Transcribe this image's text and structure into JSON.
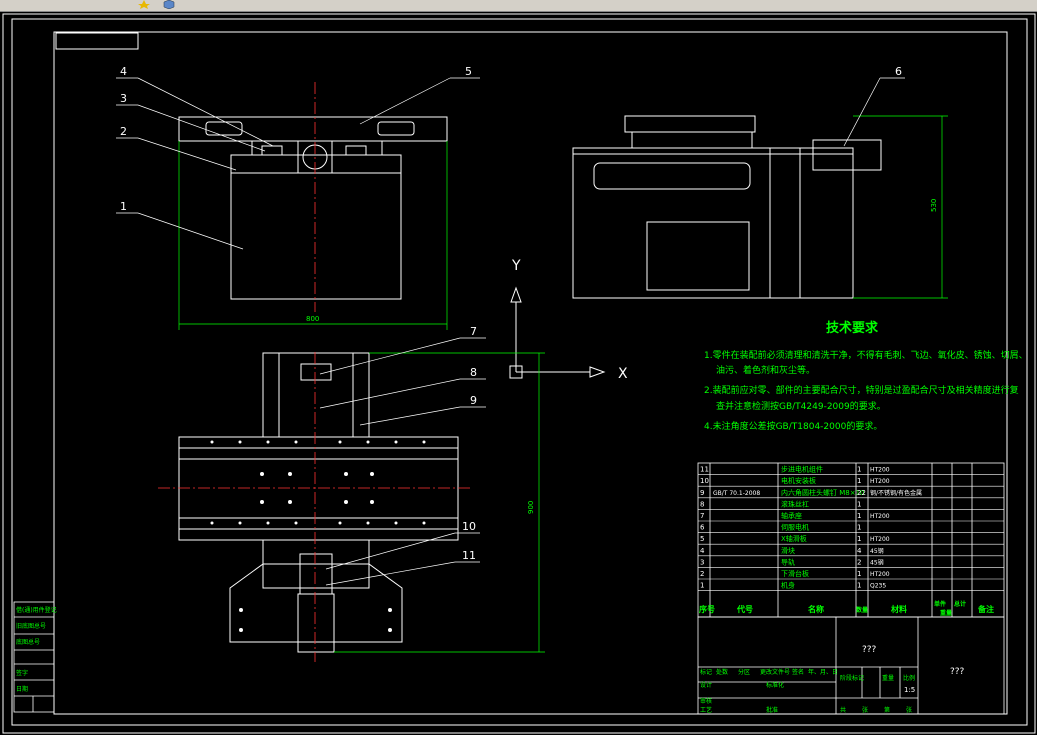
{
  "toolbar": {
    "icons": [
      "yellow-star-icon",
      "blue-cube-icon"
    ]
  },
  "drawing": {
    "axis_y_label": "Y",
    "axis_x_label": "X",
    "dim_width": "800",
    "dim_height_right": "530",
    "dim_height_bottom": "900",
    "balloons": [
      "1",
      "2",
      "3",
      "4",
      "5",
      "6",
      "7",
      "8",
      "9",
      "10",
      "11"
    ],
    "tech_title": "技术要求",
    "tech_lines": [
      "1.零件在装配前必须清理和清洗干净，不得有毛刺、飞边、氧化皮、锈蚀、切屑、",
      "油污、着色剂和灰尘等。",
      "2.装配前应对零、部件的主要配合尺寸，特别是过盈配合尺寸及相关精度进行复",
      "查并注意检测按GB/T4249-2009的要求。",
      "4.未注角度公差按GB/T1804-2000的要求。"
    ]
  },
  "bom": {
    "rows": [
      {
        "no": "11",
        "code": "",
        "name": "步进电机组件",
        "qty": "1",
        "mat": "HT200"
      },
      {
        "no": "10",
        "code": "",
        "name": "电机安装板",
        "qty": "1",
        "mat": "HT200"
      },
      {
        "no": "9",
        "code": "GB/T 70.1-2008",
        "name": "内六角圆柱头螺钉 M8×10",
        "qty": "22",
        "mat": "钢/不锈钢/有色金属"
      },
      {
        "no": "8",
        "code": "",
        "name": "滚珠丝杠",
        "qty": "1",
        "mat": ""
      },
      {
        "no": "7",
        "code": "",
        "name": "轴承座",
        "qty": "1",
        "mat": "HT200"
      },
      {
        "no": "6",
        "code": "",
        "name": "伺服电机",
        "qty": "1",
        "mat": ""
      },
      {
        "no": "5",
        "code": "",
        "name": "X轴滑板",
        "qty": "1",
        "mat": "HT200"
      },
      {
        "no": "4",
        "code": "",
        "name": "滑块",
        "qty": "4",
        "mat": "45钢"
      },
      {
        "no": "3",
        "code": "",
        "name": "导轨",
        "qty": "2",
        "mat": "45钢"
      },
      {
        "no": "2",
        "code": "",
        "name": "下滑台板",
        "qty": "1",
        "mat": "HT200"
      },
      {
        "no": "1",
        "code": "",
        "name": "机身",
        "qty": "1",
        "mat": "Q235"
      }
    ],
    "header": {
      "no": "序号",
      "code": "代号",
      "name": "名称",
      "qty": "数量",
      "mat": "材料",
      "single": "单件",
      "total": "总计",
      "weight": "重量",
      "note": "备注"
    },
    "title_q1": "???",
    "title_q2": "???",
    "scale": "1:5",
    "labels": [
      "标记",
      "处数",
      "分区",
      "更改文件号",
      "签名",
      "年、月、日",
      "设计",
      "标准化",
      "阶段标记",
      "重量",
      "比例",
      "审核",
      "工艺",
      "批准",
      "共",
      "张",
      "第",
      "张"
    ]
  },
  "left_strip": [
    "借(通)用件登记",
    "旧底图总号",
    "底图总号",
    "签字",
    "日期"
  ]
}
